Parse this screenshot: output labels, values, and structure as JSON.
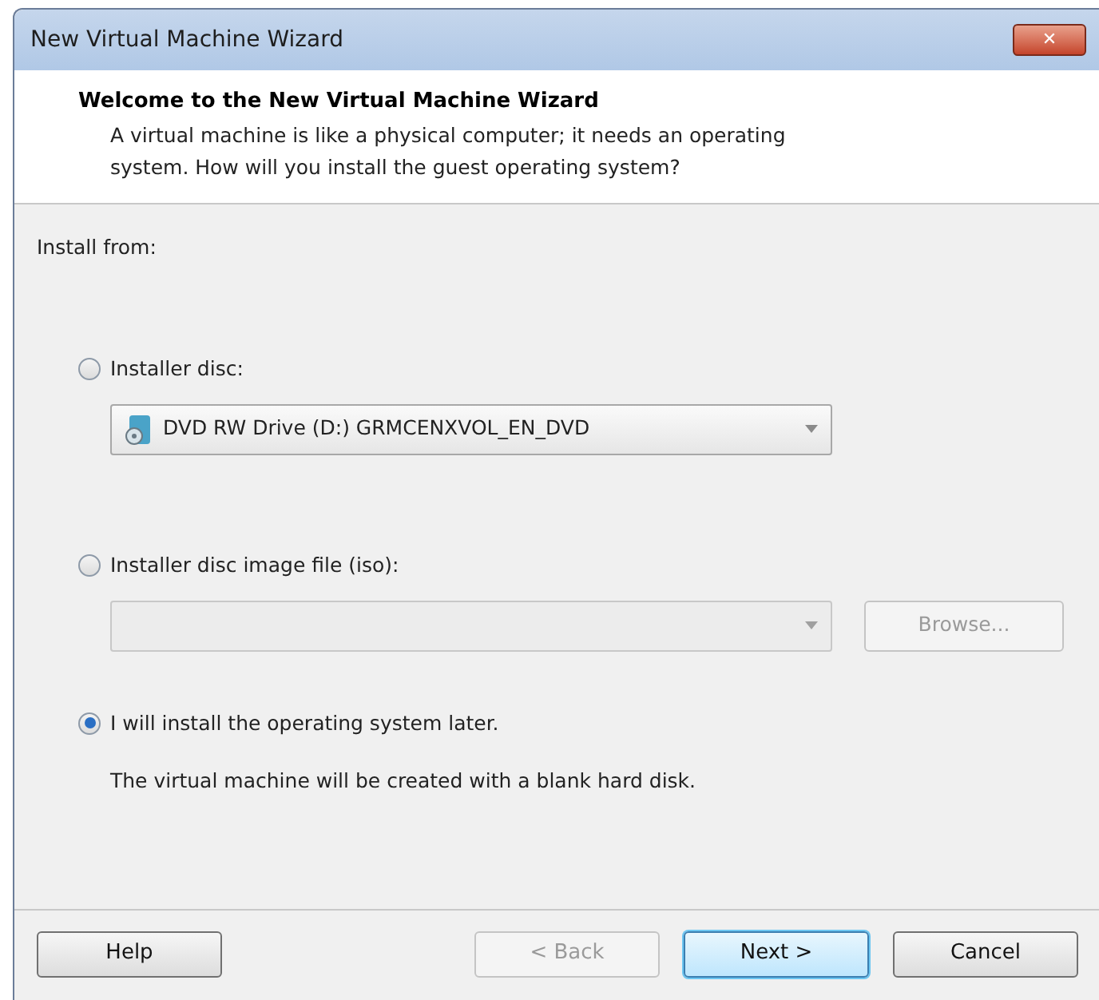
{
  "window": {
    "title": "New Virtual Machine Wizard",
    "close": "✕"
  },
  "header": {
    "title": "Welcome to the New Virtual Machine Wizard",
    "description": "A virtual machine is like a physical computer; it needs an operating system. How will you install the guest operating system?"
  },
  "group_label": "Install from:",
  "options": [
    {
      "label": "Installer disc:",
      "selected": false,
      "dropdown": {
        "value": "DVD RW Drive (D:) GRMCENXVOL_EN_DVD",
        "disabled": false
      }
    },
    {
      "label": "Installer disc image file (iso):",
      "selected": false,
      "dropdown": {
        "disabled": true
      },
      "browse": {
        "label": "Browse...",
        "disabled": true
      }
    },
    {
      "label": "I will install the operating system later.",
      "selected": true,
      "note": "The virtual machine will be created with a blank hard disk."
    }
  ],
  "buttons": [
    {
      "label": "Help",
      "disabled": false,
      "default": false
    },
    {
      "label": "< Back",
      "disabled": true,
      "default": false
    },
    {
      "label": "Next >",
      "disabled": false,
      "default": true
    },
    {
      "label": "Cancel",
      "disabled": false,
      "default": false
    }
  ]
}
